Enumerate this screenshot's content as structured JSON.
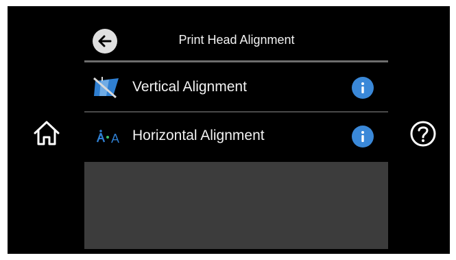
{
  "header": {
    "title": "Print Head Alignment",
    "back_icon": "back-arrow-icon"
  },
  "menu": {
    "items": [
      {
        "label": "Vertical Alignment",
        "icon": "vertical-alignment-icon",
        "info_icon": "info-icon"
      },
      {
        "label": "Horizontal Alignment",
        "icon": "horizontal-alignment-icon",
        "info_icon": "info-icon",
        "icon_text": "A"
      }
    ]
  },
  "side": {
    "home_icon": "home-icon",
    "help_icon": "help-icon"
  },
  "colors": {
    "background": "#000000",
    "info_blue": "#3a88d8",
    "icon_blue": "#2f7fd1",
    "panel_gray": "#3c3c3c"
  }
}
